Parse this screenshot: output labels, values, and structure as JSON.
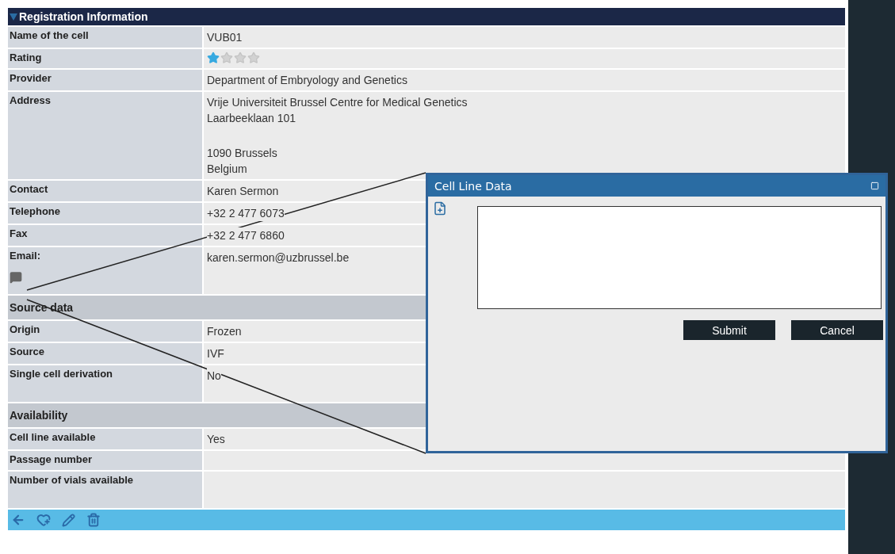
{
  "panel": {
    "title": "Registration Information",
    "expanded": true
  },
  "rows": [
    {
      "kind": "field",
      "label": "Name of the cell",
      "value": "VUB01"
    },
    {
      "kind": "rating",
      "label": "Rating",
      "stars": 1
    },
    {
      "kind": "field",
      "label": "Provider",
      "value": "Department of Embryology and Genetics"
    },
    {
      "kind": "address",
      "label": "Address",
      "blocks": [
        [
          "Vrije Universiteit Brussel Centre for Medical Genetics",
          "Laarbeeklaan 101"
        ],
        [
          "1090 Brussels",
          "Belgium"
        ]
      ]
    },
    {
      "kind": "field",
      "label": "Contact",
      "value": "Karen Sermon"
    },
    {
      "kind": "field",
      "label": "Telephone",
      "value": "+32 2 477 6073"
    },
    {
      "kind": "field",
      "label": "Fax",
      "value": "+32 2 477 6860"
    },
    {
      "kind": "field",
      "label": "Email:",
      "value": "karen.sermon@uzbrussel.be",
      "comment": true
    },
    {
      "kind": "section",
      "label": "Source data"
    },
    {
      "kind": "field",
      "label": "Origin",
      "value": "Frozen"
    },
    {
      "kind": "field",
      "label": "Source",
      "value": "IVF"
    },
    {
      "kind": "field",
      "label": "Single cell derivation",
      "value": "No"
    },
    {
      "kind": "section",
      "label": "Availability"
    },
    {
      "kind": "field",
      "label": "Cell line available",
      "value": "Yes"
    },
    {
      "kind": "field",
      "label": "Passage number"
    },
    {
      "kind": "field",
      "label": "Number of vials available"
    }
  ],
  "dialog": {
    "title": "Cell Line Data",
    "buttons": [
      "Submit",
      "Cancel"
    ]
  }
}
